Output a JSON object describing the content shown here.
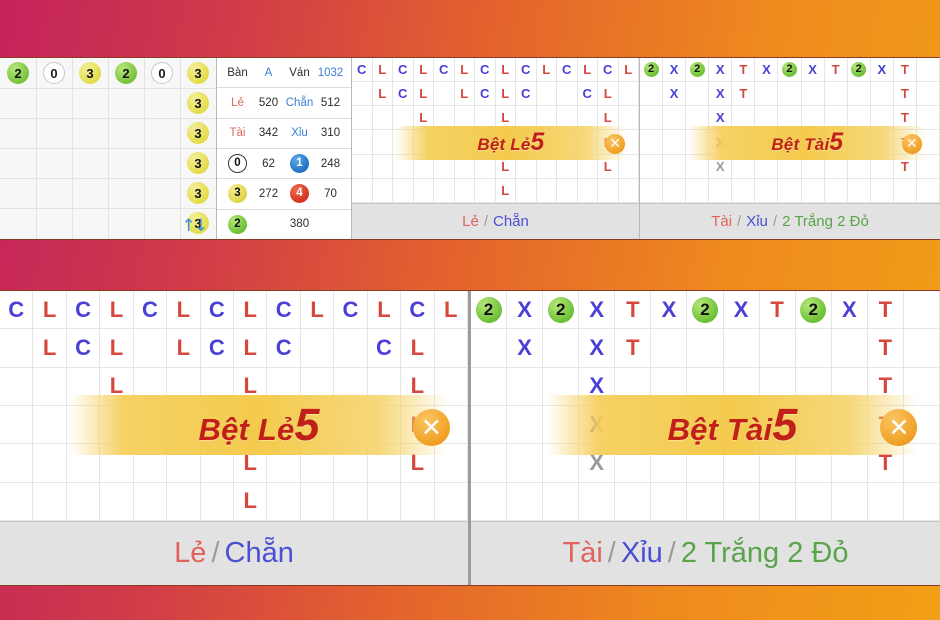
{
  "theme": {
    "bg_gradient_from": "#c4235c",
    "bg_gradient_to": "#f2a016",
    "accent_orange": "#f0a024",
    "banner_yellow": "#f3c948",
    "mark_blue": "#4a3fd6",
    "mark_red": "#d6483f",
    "green_badge": "#6bbf32"
  },
  "top": {
    "badge_row": [
      {
        "value": "2",
        "color": "green"
      },
      {
        "value": "0",
        "color": "white"
      },
      {
        "value": "3",
        "color": "yellow"
      },
      {
        "value": "2",
        "color": "green"
      },
      {
        "value": "0",
        "color": "white"
      },
      {
        "value": "3",
        "color": "yellow"
      }
    ],
    "badge_column_extra": [
      {
        "value": "3",
        "color": "yellow"
      },
      {
        "value": "3",
        "color": "yellow"
      },
      {
        "value": "3",
        "color": "yellow"
      },
      {
        "value": "3",
        "color": "yellow"
      },
      {
        "value": "3",
        "color": "yellow"
      }
    ],
    "sort_arrows_icon": "sort-up-down-arrows",
    "stats": {
      "rows": [
        {
          "cells": [
            {
              "text": "Bàn",
              "style": "lbl-dark"
            },
            {
              "text": "A",
              "style": "lbl-blue"
            },
            {
              "text": "Ván",
              "style": "lbl-dark"
            },
            {
              "text": "1032",
              "style": "num-blue"
            }
          ]
        },
        {
          "cells": [
            {
              "text": "Lẻ",
              "style": "lbl-red"
            },
            {
              "text": "520",
              "style": "num"
            },
            {
              "text": "Chẵn",
              "style": "lbl-blue"
            },
            {
              "text": "512",
              "style": "num"
            }
          ]
        },
        {
          "cells": [
            {
              "text": "Tài",
              "style": "lbl-red"
            },
            {
              "text": "342",
              "style": "num"
            },
            {
              "text": "Xỉu",
              "style": "lbl-blue"
            },
            {
              "text": "310",
              "style": "num"
            }
          ]
        },
        {
          "cells": [
            {
              "badge": "0",
              "badge_color": "white"
            },
            {
              "text": "62",
              "style": "num"
            },
            {
              "badge": "1",
              "badge_color": "blue"
            },
            {
              "text": "248",
              "style": "num"
            }
          ]
        },
        {
          "cells": [
            {
              "badge": "3",
              "badge_color": "yellow"
            },
            {
              "text": "272",
              "style": "num"
            },
            {
              "badge": "4",
              "badge_color": "red"
            },
            {
              "text": "70",
              "style": "num"
            }
          ]
        },
        {
          "cells": [
            {
              "badge": "2",
              "badge_color": "green"
            },
            {
              "text": "380",
              "style": "num",
              "span": 3
            }
          ]
        }
      ]
    }
  },
  "le_chan_road": {
    "name": "le-chan-road",
    "cols": 14,
    "rows": 6,
    "marks": [
      {
        "c": 1,
        "r": 1,
        "t": "C"
      },
      {
        "c": 2,
        "r": 1,
        "t": "L"
      },
      {
        "c": 3,
        "r": 1,
        "t": "C"
      },
      {
        "c": 4,
        "r": 1,
        "t": "L"
      },
      {
        "c": 5,
        "r": 1,
        "t": "C"
      },
      {
        "c": 6,
        "r": 1,
        "t": "L"
      },
      {
        "c": 7,
        "r": 1,
        "t": "C"
      },
      {
        "c": 8,
        "r": 1,
        "t": "L"
      },
      {
        "c": 9,
        "r": 1,
        "t": "C"
      },
      {
        "c": 10,
        "r": 1,
        "t": "L"
      },
      {
        "c": 11,
        "r": 1,
        "t": "C"
      },
      {
        "c": 12,
        "r": 1,
        "t": "L"
      },
      {
        "c": 13,
        "r": 1,
        "t": "C"
      },
      {
        "c": 14,
        "r": 1,
        "t": "L"
      },
      {
        "c": 2,
        "r": 2,
        "t": "L"
      },
      {
        "c": 3,
        "r": 2,
        "t": "C"
      },
      {
        "c": 4,
        "r": 2,
        "t": "L"
      },
      {
        "c": 6,
        "r": 2,
        "t": "L"
      },
      {
        "c": 7,
        "r": 2,
        "t": "C"
      },
      {
        "c": 8,
        "r": 2,
        "t": "L"
      },
      {
        "c": 9,
        "r": 2,
        "t": "C"
      },
      {
        "c": 12,
        "r": 2,
        "t": "C"
      },
      {
        "c": 13,
        "r": 2,
        "t": "L"
      },
      {
        "c": 4,
        "r": 3,
        "t": "L"
      },
      {
        "c": 8,
        "r": 3,
        "t": "L"
      },
      {
        "c": 13,
        "r": 3,
        "t": "L"
      },
      {
        "c": 8,
        "r": 4,
        "t": "L"
      },
      {
        "c": 13,
        "r": 4,
        "t": "L"
      },
      {
        "c": 8,
        "r": 5,
        "t": "L"
      },
      {
        "c": 13,
        "r": 5,
        "t": "L"
      },
      {
        "c": 8,
        "r": 6,
        "t": "L"
      }
    ],
    "banner_label": "Bệt Lẻ",
    "banner_number": "5",
    "close_icon": "close-x-icon",
    "footer": [
      {
        "text": "Lẻ",
        "style": "f-red"
      },
      {
        "text": "/",
        "style": "f-sep"
      },
      {
        "text": "Chẵn",
        "style": "f-blue"
      }
    ]
  },
  "tai_xiu_road": {
    "name": "tai-xiu-road",
    "cols": 13,
    "rows": 6,
    "marks": [
      {
        "c": 1,
        "r": 1,
        "t": "2",
        "k": "n2"
      },
      {
        "c": 2,
        "r": 1,
        "t": "X"
      },
      {
        "c": 3,
        "r": 1,
        "t": "2",
        "k": "n2"
      },
      {
        "c": 4,
        "r": 1,
        "t": "X"
      },
      {
        "c": 5,
        "r": 1,
        "t": "T"
      },
      {
        "c": 6,
        "r": 1,
        "t": "X"
      },
      {
        "c": 7,
        "r": 1,
        "t": "2",
        "k": "n2"
      },
      {
        "c": 8,
        "r": 1,
        "t": "X"
      },
      {
        "c": 9,
        "r": 1,
        "t": "T"
      },
      {
        "c": 10,
        "r": 1,
        "t": "2",
        "k": "n2"
      },
      {
        "c": 11,
        "r": 1,
        "t": "X"
      },
      {
        "c": 12,
        "r": 1,
        "t": "T"
      },
      {
        "c": 2,
        "r": 2,
        "t": "X"
      },
      {
        "c": 4,
        "r": 2,
        "t": "X"
      },
      {
        "c": 5,
        "r": 2,
        "t": "T"
      },
      {
        "c": 12,
        "r": 2,
        "t": "T"
      },
      {
        "c": 4,
        "r": 3,
        "t": "X"
      },
      {
        "c": 12,
        "r": 3,
        "t": "T"
      },
      {
        "c": 4,
        "r": 4,
        "t": "X"
      },
      {
        "c": 12,
        "r": 4,
        "t": "T"
      },
      {
        "c": 4,
        "r": 5,
        "t": "X",
        "k": "Xg"
      },
      {
        "c": 12,
        "r": 5,
        "t": "T"
      }
    ],
    "banner_label": "Bệt Tài",
    "banner_number": "5",
    "close_icon": "close-x-icon",
    "footer": [
      {
        "text": "Tài",
        "style": "f-red"
      },
      {
        "text": "/",
        "style": "f-sep"
      },
      {
        "text": "Xỉu",
        "style": "f-blue"
      },
      {
        "text": "/",
        "style": "f-sep"
      },
      {
        "text": "2 Trắng 2 Đỏ",
        "style": "f-green"
      }
    ]
  }
}
